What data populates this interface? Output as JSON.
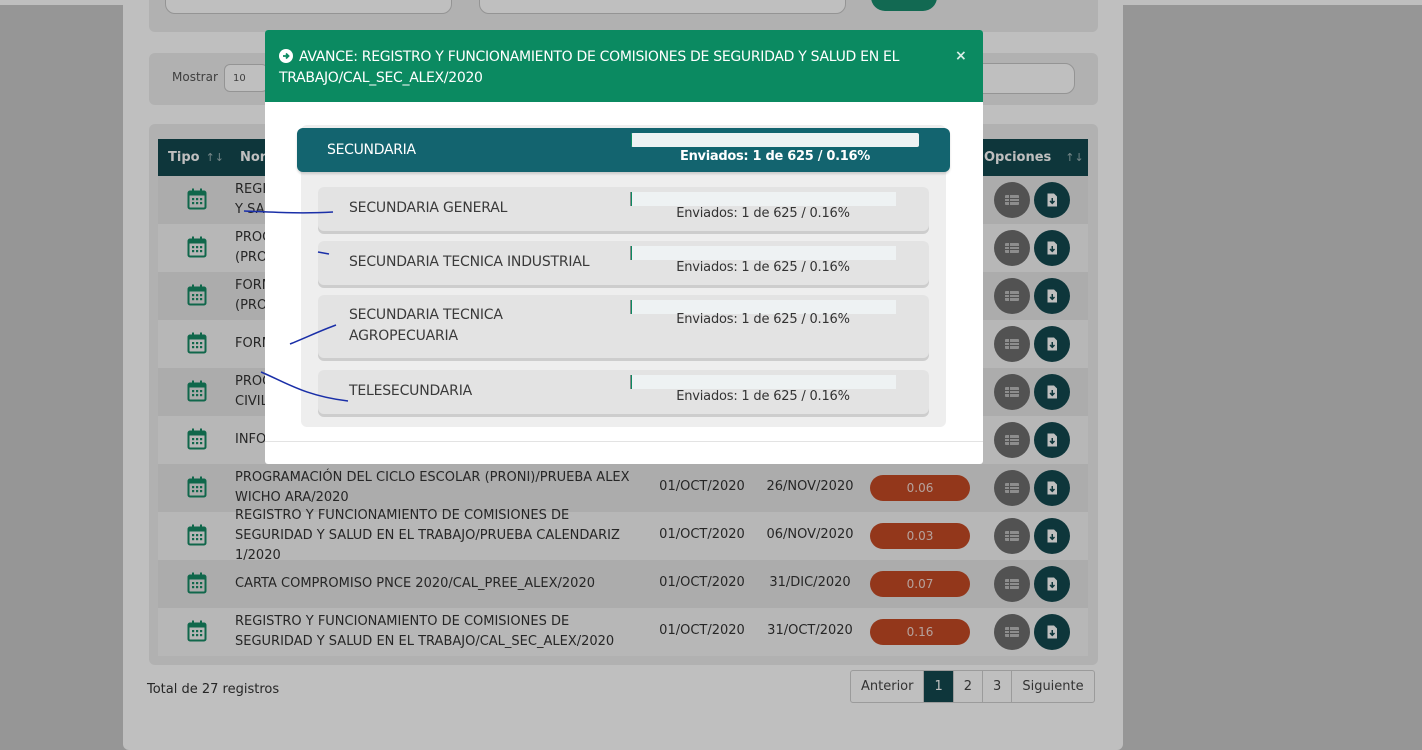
{
  "toolbar": {
    "show_label": "Mostrar",
    "page_size": "10"
  },
  "table": {
    "headers": {
      "tipo": "Tipo",
      "nombre": "Non",
      "opciones": "Opciones"
    },
    "rows": [
      {
        "name": "REGI\nY SA",
        "start": "",
        "end": "",
        "progress": ""
      },
      {
        "name": "PROG\n(PRO",
        "start": "",
        "end": "",
        "progress": ""
      },
      {
        "name": "FORM\n(PRO",
        "start": "",
        "end": "",
        "progress": ""
      },
      {
        "name": "FORM",
        "start": "",
        "end": "",
        "progress": ""
      },
      {
        "name": "PROC\nCIVIL",
        "start": "",
        "end": "",
        "progress": ""
      },
      {
        "name": "INFO",
        "start": "",
        "end": "",
        "progress": ""
      },
      {
        "name": "PROGRAMACIÓN DEL CICLO ESCOLAR (PRONI)/PRUEBA ALEX WICHO ARA/2020",
        "start": "01/OCT/2020",
        "end": "26/NOV/2020",
        "progress": "0.06"
      },
      {
        "name": "REGISTRO Y FUNCIONAMIENTO DE COMISIONES DE SEGURIDAD Y SALUD EN EL TRABAJO/PRUEBA CALENDARIZ 1/2020",
        "start": "01/OCT/2020",
        "end": "06/NOV/2020",
        "progress": "0.03"
      },
      {
        "name": "CARTA COMPROMISO PNCE 2020/CAL_PREE_ALEX/2020",
        "start": "01/OCT/2020",
        "end": "31/DIC/2020",
        "progress": "0.07"
      },
      {
        "name": "REGISTRO Y FUNCIONAMIENTO DE COMISIONES DE SEGURIDAD Y SALUD EN EL TRABAJO/CAL_SEC_ALEX/2020",
        "start": "01/OCT/2020",
        "end": "31/OCT/2020",
        "progress": "0.16"
      }
    ]
  },
  "footer": {
    "total": "Total de 27 registros",
    "pager": [
      "Anterior",
      "1",
      "2",
      "3",
      "Siguiente"
    ],
    "active_page": "1"
  },
  "modal": {
    "title": "AVANCE: REGISTRO Y FUNCIONAMIENTO DE COMISIONES DE SEGURIDAD Y SALUD EN EL TRABAJO/CAL_SEC_ALEX/2020",
    "close": "×",
    "level": {
      "name": "SECUNDARIA",
      "status": "Enviados: 1 de 625 / 0.16%",
      "fraction": 0.0016
    },
    "items": [
      {
        "name": "SECUNDARIA GENERAL",
        "status": "Enviados: 1 de 625 / 0.16%",
        "fraction": 0.0016
      },
      {
        "name": "SECUNDARIA TECNICA INDUSTRIAL",
        "status": "Enviados: 1 de 625 / 0.16%",
        "fraction": 0.0016
      },
      {
        "name": "SECUNDARIA TECNICA AGROPECUARIA",
        "status": "Enviados: 1 de 625 / 0.16%",
        "fraction": 0.0016
      },
      {
        "name": "TELESECUNDARIA",
        "status": "Enviados: 1 de 625 / 0.16%",
        "fraction": 0.0016
      }
    ]
  },
  "colors": {
    "accent_green": "#0b8a61",
    "dark_teal": "#13494f",
    "panel_teal": "#13646f",
    "progress_orange": "#c54a25",
    "annotation_ink": "#1a2fa8"
  }
}
